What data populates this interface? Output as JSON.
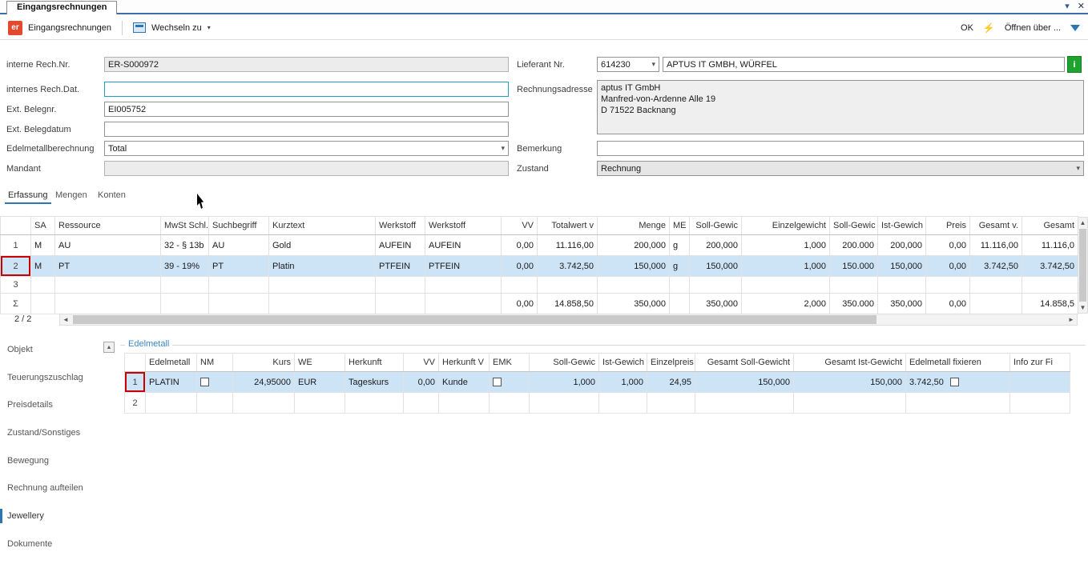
{
  "window": {
    "tab_title": "Eingangsrechnungen",
    "dropdown_glyph": "▾",
    "close_glyph": "✕"
  },
  "toolbar": {
    "app_badge": "er",
    "title": "Eingangsrechnungen",
    "wechseln_label": "Wechseln zu",
    "wechseln_arrow": "▾",
    "ok_label": "OK",
    "lightning_glyph": "⚡",
    "oeffnen_label": "Öffnen über ..."
  },
  "form": {
    "fields_left": [
      {
        "label": "interne Rech.Nr.",
        "value": "ER-S000972"
      },
      {
        "label": "internes Rech.Dat.",
        "value": ""
      },
      {
        "label": "Ext. Belegnr.",
        "value": "EI005752"
      },
      {
        "label": "Ext. Belegdatum",
        "value": ""
      },
      {
        "label": "Edelmetallberechnung",
        "value": "Total"
      },
      {
        "label": "Mandant",
        "value": ""
      }
    ],
    "lieferant_label": "Lieferant Nr.",
    "lieferant_nr": "614230",
    "lieferant_name": "APTUS IT GMBH, WÜRFEL",
    "info_button_label": "i",
    "adresse_label": "Rechnungsadresse",
    "adresse_value": "aptus IT GmbH\nManfred-von-Ardenne Alle 19\nD 71522 Backnang",
    "bemerkung_label": "Bemerkung",
    "bemerkung_value": "",
    "zustand_label": "Zustand",
    "zustand_value": "Rechnung"
  },
  "tabs": [
    {
      "label": "Erfassung",
      "active": true
    },
    {
      "label": "Mengen",
      "active": false
    },
    {
      "label": "Konten",
      "active": false
    }
  ],
  "grid": {
    "columns": [
      "SA",
      "Ressource",
      "MwSt Schl.",
      "Suchbegriff",
      "Kurztext",
      "Werkstoff",
      "Werkstoff",
      "VV",
      "Totalwert v",
      "Menge",
      "ME",
      "Soll-Gewic",
      "Einzelgewicht",
      "Soll-Gewic",
      "Ist-Gewich",
      "Preis",
      "Gesamt v.",
      "Gesamt"
    ],
    "rows": [
      {
        "num": "1",
        "c": [
          "M",
          "AU",
          "32 - § 13b",
          "AU",
          "Gold",
          "AUFEIN",
          "AUFEIN",
          "0,00",
          "11.116,00",
          "200,000",
          "g",
          "200,000",
          "1,000",
          "200.000",
          "200,000",
          "0,00",
          "11.116,00",
          "11.116,0"
        ]
      },
      {
        "num": "2",
        "c": [
          "M",
          "PT",
          "39 - 19%",
          "PT",
          "Platin",
          "PTFEIN",
          "PTFEIN",
          "0,00",
          "3.742,50",
          "150,000",
          "g",
          "150,000",
          "1,000",
          "150.000",
          "150,000",
          "0,00",
          "3.742,50",
          "3.742,50"
        ]
      },
      {
        "num": "3",
        "c": [
          "",
          "",
          "",
          "",
          "",
          "",
          "",
          "",
          "",
          "",
          "",
          "",
          "",
          "",
          "",
          "",
          "",
          ""
        ]
      }
    ],
    "sum": {
      "num": "Σ",
      "c": [
        "",
        "",
        "",
        "",
        "",
        "",
        "",
        "0,00",
        "14.858,50",
        "350,000",
        "",
        "350,000",
        "2,000",
        "350.000",
        "350,000",
        "0,00",
        "",
        "14.858,5"
      ]
    },
    "status": "2 / 2"
  },
  "sidebar": {
    "items": [
      "Objekt",
      "Teuerungszuschlag",
      "Preisdetails",
      "Zustand/Sonstiges",
      "Bewegung",
      "Rechnung aufteilen",
      "Jewellery",
      "Dokumente"
    ],
    "selected": "Jewellery"
  },
  "edelmetall": {
    "title": "Edelmetall",
    "columns": [
      "Edelmetall",
      "NM",
      "Kurs",
      "WE",
      "Herkunft",
      "VV",
      "Herkunft V",
      "EMK",
      "Soll-Gewic",
      "Ist-Gewich",
      "Einzelpreis",
      "Gesamt Soll-Gewicht",
      "Gesamt Ist-Gewicht",
      "Edelmetall fixieren",
      "Info zur Fi"
    ],
    "row1": {
      "num": "1",
      "edelmetall": "PLATIN",
      "kurs": "24,95000",
      "we": "EUR",
      "herkunft": "Tageskurs",
      "vv": "0,00",
      "herkunft_v": "Kunde",
      "soll": "1,000",
      "ist": "1,000",
      "einzelpreis": "24,95",
      "gesamt_soll": "150,000",
      "gesamt_ist": "150,000",
      "fixieren": "3.742,50"
    },
    "row2": {
      "num": "2"
    }
  }
}
